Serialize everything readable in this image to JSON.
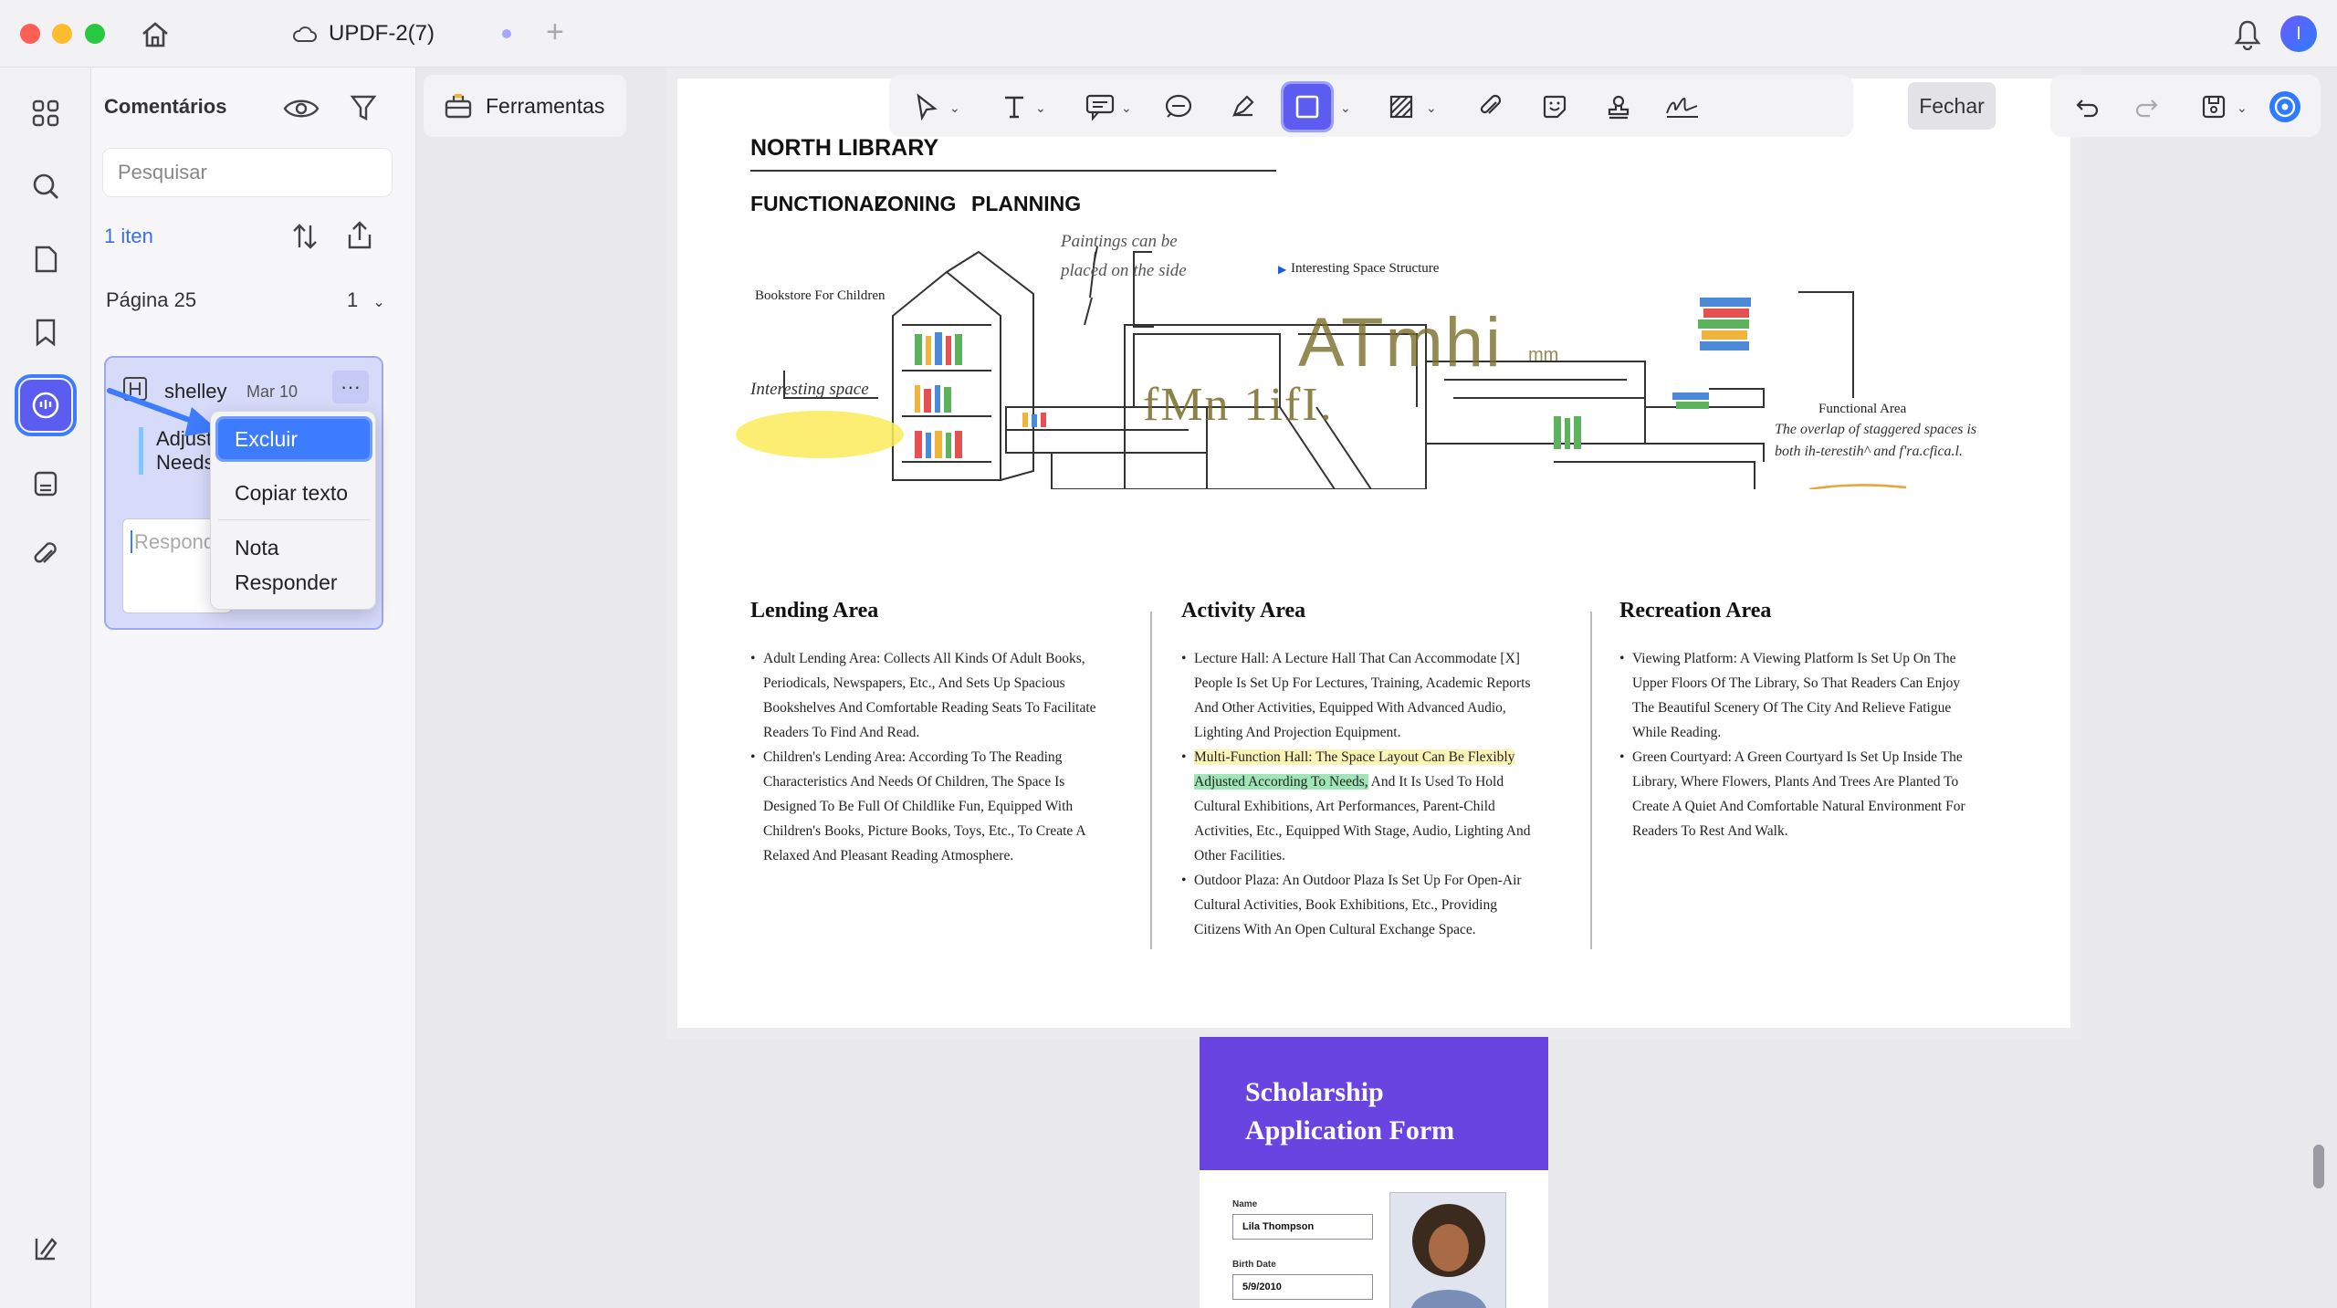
{
  "titlebar": {
    "doc_name": "UPDF-2(7)",
    "avatar_letter": "I"
  },
  "comments_panel": {
    "title": "Comentários",
    "search_placeholder": "Pesquisar",
    "count": "1 iten",
    "page_label": "Página 25",
    "page_count": "1",
    "card": {
      "user": "shelley",
      "date": "Mar 10",
      "more": "···",
      "text_line1": "Adjuste",
      "text_line2": "Needs",
      "reply_placeholder": "Respond"
    },
    "context_menu": {
      "delete": "Excluir",
      "copy_text": "Copiar texto",
      "note": "Nota",
      "reply": "Responder"
    }
  },
  "toolbar": {
    "tools_label": "Ferramentas",
    "close_label": "Fechar"
  },
  "page": {
    "title": "NORTH LIBRARY",
    "subtitles": [
      "FUNCTIONAL",
      "ZONING",
      "PLANNING"
    ],
    "illustration": {
      "bookstore": "Bookstore For Children",
      "paintings_note_1": "Paintings can be",
      "paintings_note_2": "placed on the side",
      "interesting_structure": "Interesting Space Structure",
      "interesting_space": "Interesting space",
      "functional_area": "Functional Area",
      "overlap_note_1": "The overlap of staggered spaces is",
      "overlap_note_2": "both ih-terestih^ and f'ra.cfica.l.",
      "ocr_text_1": "ATmhi",
      "ocr_text_1b": "mm",
      "ocr_text_2": "fMn 1ifI."
    },
    "sections": [
      {
        "title": "Lending Area",
        "items": [
          "Adult Lending Area: Collects All Kinds Of Adult Books, Periodicals, Newspapers, Etc., And Sets Up Spacious Bookshelves And Comfortable Reading Seats To Facilitate Readers To Find And Read.",
          "Children's Lending Area: According To The Reading Characteristics And Needs Of Children, The Space Is Designed To Be Full Of Childlike Fun, Equipped With Children's Books, Picture Books, Toys, Etc., To Create A Relaxed And Pleasant Reading Atmosphere."
        ]
      },
      {
        "title": "Activity Area",
        "item1": "Lecture Hall: A Lecture Hall That Can Accommodate [X] People Is Set Up For Lectures, Training, Academic Reports And Other Activities, Equipped With Advanced Audio, Lighting And Projection Equipment.",
        "item2_hl_yellow": "Multi-Function Hall: The Space Layout Can Be Flexibly",
        "item2_hl_green": "Adjusted According To Needs,",
        "item2_rest": " And It Is Used To Hold Cultural Exhibitions, Art Performances, Parent-Child Activities, Etc., Equipped With Stage, Audio, Lighting And Other Facilities.",
        "item3": "Outdoor Plaza: An Outdoor Plaza Is Set Up For Open-Air Cultural Activities, Book Exhibitions, Etc., Providing Citizens With An Open Cultural Exchange Space."
      },
      {
        "title": "Recreation Area",
        "items": [
          "Viewing Platform: A Viewing Platform Is Set Up On The Upper Floors Of The Library, So That Readers Can Enjoy The Beautiful Scenery Of The City And Relieve Fatigue While Reading.",
          "Green Courtyard: A Green Courtyard Is Set Up Inside The Library, Where Flowers, Plants And Trees Are Planted To Create A Quiet And Comfortable Natural Environment For Readers To Rest And Walk."
        ]
      }
    ]
  },
  "page2": {
    "title": "Scholarship Application Form",
    "name_label": "Name",
    "name_value": "Lila Thompson",
    "birth_label": "Birth Date",
    "birth_value": "5/9/2010"
  },
  "colors": {
    "accent": "#5b5cf0",
    "highlight_blue": "#3e7cff",
    "form_header": "#6a44e0"
  }
}
